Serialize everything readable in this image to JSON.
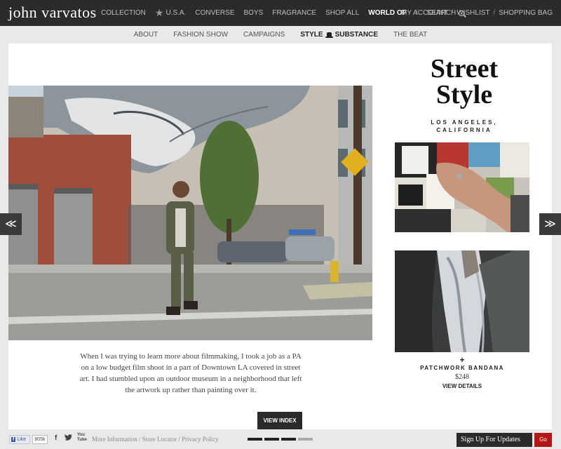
{
  "header": {
    "brand": "john varvatos",
    "nav": [
      {
        "label": "COLLECTION"
      },
      {
        "label": "U.S.A."
      },
      {
        "label": "CONVERSE"
      },
      {
        "label": "BOYS"
      },
      {
        "label": "FRAGRANCE"
      },
      {
        "label": "SHOP ALL"
      },
      {
        "label": "WORLD OF"
      }
    ],
    "sep": "/",
    "search_label": "SEARCH",
    "account": "MY ACCOUNT",
    "wishlist": "WISHLIST",
    "bag": "SHOPPING BAG"
  },
  "subnav": {
    "about": "ABOUT",
    "fashion_show": "FASHION SHOW",
    "campaigns": "CAMPAIGNS",
    "style": "STYLE",
    "substance": "SUBSTANCE",
    "beat": "THE BEAT"
  },
  "feature": {
    "title_line1": "Street",
    "title_line2": "Style",
    "location_line1": "LOS ANGELES,",
    "location_line2": "CALIFORNIA",
    "caption": "When I was trying to learn more about filmmaking, I took a job as a PA on a low budget film shoot in a part of Downtown LA covered in street art. I had stumbled upon an outdoor museum in a neighborhood that left the artwork up rather than painting over it.",
    "view_index": "VIEW INDEX"
  },
  "product": {
    "plus": "+",
    "name": "PATCHWORK BANDANA",
    "price": "$248",
    "view_details": "VIEW DETAILS"
  },
  "arrows": {
    "prev": "≪",
    "next": "≫"
  },
  "footer": {
    "like": "Like",
    "like_count": "805k",
    "fb": "f",
    "yt_top": "You",
    "yt_bottom": "Tube",
    "more_info": "More Information",
    "store_locator": "Store Locator",
    "privacy": "Privacy Policy",
    "link_sep": " / ",
    "signup": "Sign Up For Updates",
    "go": "Go"
  },
  "pager": {
    "total": 4,
    "active": 3
  },
  "colors": {
    "dark": "#2b2b2b",
    "accent_red": "#b41616",
    "panel": "#ffffff"
  }
}
